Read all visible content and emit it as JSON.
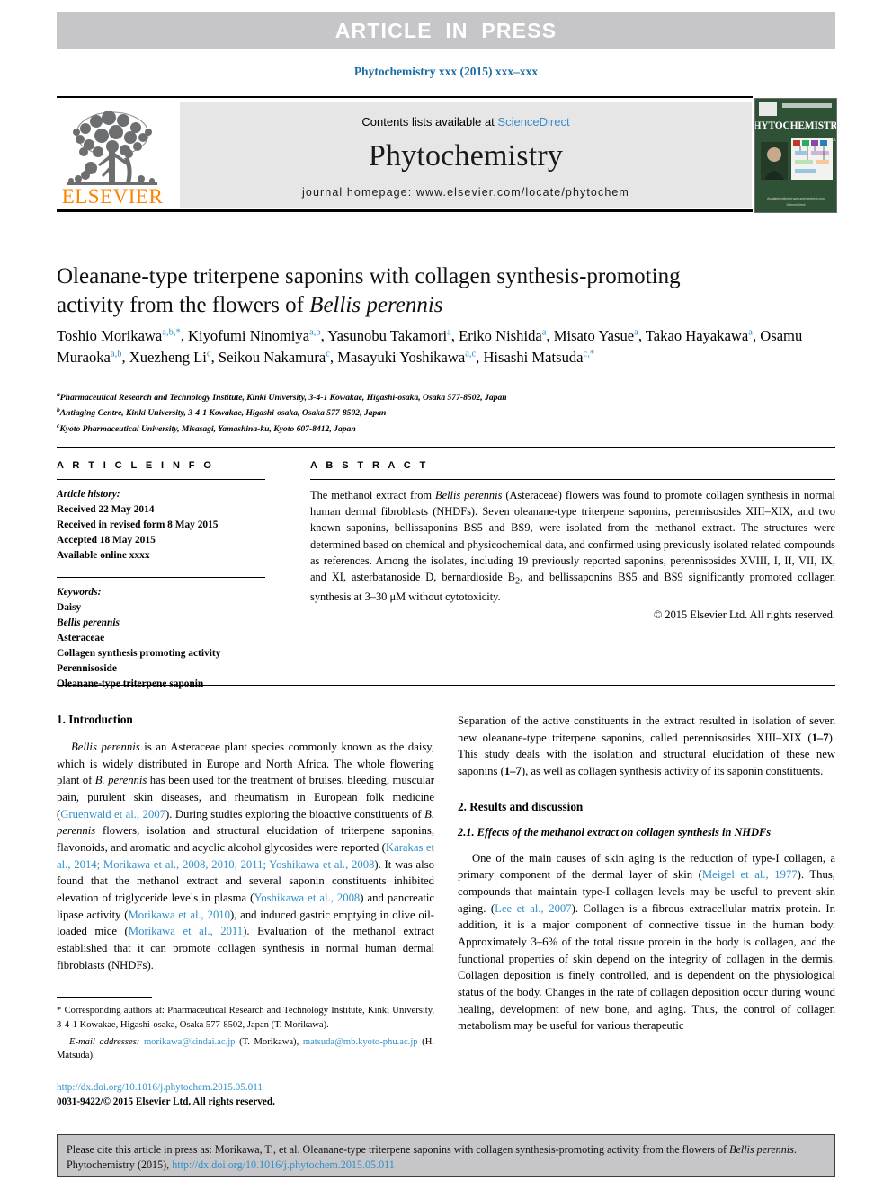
{
  "banner": {
    "text": "ARTICLE  IN  PRESS"
  },
  "running_head": "Phytochemistry xxx (2015) xxx–xxx",
  "masthead": {
    "contents_prefix": "Contents lists available at ",
    "sciencedirect": "ScienceDirect",
    "journal_name": "Phytochemistry",
    "homepage": "journal homepage: www.elsevier.com/locate/phytochem",
    "publisher_wordmark": "ELSEVIER",
    "cover": {
      "title": "PHYTOCHEMISTRY",
      "subtitle_lines": [
        "MOLECULAR BIOLOGY",
        "BIOCHEMISTRY",
        "CHEMISTRY"
      ],
      "footer": "Available online at www.sciencedirect.com"
    }
  },
  "article": {
    "title_line1": "Oleanane-type triterpene saponins with collagen synthesis-promoting",
    "title_line2_pre": "activity from the flowers of ",
    "title_line2_italic": "Bellis perennis",
    "authors_html": "Toshio Morikawa<sup>a,b,*</sup>, Kiyofumi Ninomiya<sup>a,b</sup>, Yasunobu Takamori<sup>a</sup>, Eriko Nishida<sup>a</sup>, Misato Yasue<sup>a</sup>, Takao Hayakawa<sup>a</sup>, Osamu Muraoka<sup>a,b</sup>, Xuezheng Li<sup>c</sup>, Seikou Nakamura<sup>c</sup>, Masayuki Yoshikawa<sup>a,c</sup>, Hisashi Matsuda<sup>c,*</sup>",
    "affiliations": [
      {
        "marker": "a",
        "text": "Pharmaceutical Research and Technology Institute, Kinki University, 3-4-1 Kowakae, Higashi-osaka, Osaka 577-8502, Japan"
      },
      {
        "marker": "b",
        "text": "Antiaging Centre, Kinki University, 3-4-1 Kowakae, Higashi-osaka, Osaka 577-8502, Japan"
      },
      {
        "marker": "c",
        "text": "Kyoto Pharmaceutical University, Misasagi, Yamashina-ku, Kyoto 607-8412, Japan"
      }
    ]
  },
  "article_info": {
    "heading": "A R T I C L E   I N F O",
    "history_label": "Article history:",
    "history": [
      "Received 22 May 2014",
      "Received in revised form 8 May 2015",
      "Accepted 18 May 2015",
      "Available online xxxx"
    ],
    "keywords_label": "Keywords:",
    "keywords": [
      "Daisy",
      "Bellis perennis",
      "Asteraceae",
      "Collagen synthesis promoting activity",
      "Perennisoside",
      "Oleanane-type triterpene saponin"
    ],
    "keywords_italic_index": 1
  },
  "abstract": {
    "heading": "A B S T R A C T",
    "body_html": "The methanol extract from <i>Bellis perennis</i> (Asteraceae) flowers was found to promote collagen synthesis in normal human dermal fibroblasts (NHDFs). Seven oleanane-type triterpene saponins, perennisosides XIII–XIX, and two known saponins, bellissaponins BS5 and BS9, were isolated from the methanol extract. The structures were determined based on chemical and physicochemical data, and confirmed using previously isolated related compounds as references. Among the isolates, including 19 previously reported saponins, perennisosides XVIII, I, II, VII, IX, and XI, asterbatanoside D, bernardioside B<sub>2</sub>, and bellissaponins BS5 and BS9 significantly promoted collagen synthesis at 3–30 μM without cytotoxicity.",
    "copyright": "© 2015 Elsevier Ltd. All rights reserved."
  },
  "body": {
    "left": {
      "intro_heading": "1. Introduction",
      "intro_html": "<i>Bellis perennis</i> is an Asteraceae plant species commonly known as the daisy, which is widely distributed in Europe and North Africa. The whole flowering plant of <i>B. perennis</i> has been used for the treatment of bruises, bleeding, muscular pain, purulent skin diseases, and rheumatism in European folk medicine (<span class=\"cit\">Gruenwald et al., 2007</span>). During studies exploring the bioactive constituents of <i>B. perennis</i> flowers, isolation and structural elucidation of triterpene saponins, flavonoids, and aromatic and acyclic alcohol glycosides were reported (<span class=\"cit\">Karakas et al., 2014; Morikawa et al., 2008, 2010, 2011; Yoshikawa et al., 2008</span>). It was also found that the methanol extract and several saponin constituents inhibited elevation of triglyceride levels in plasma (<span class=\"cit\">Yoshikawa et al., 2008</span>) and pancreatic lipase activity (<span class=\"cit\">Morikawa et al., 2010</span>), and induced gastric emptying in olive oil-loaded mice (<span class=\"cit\">Morikawa et al., 2011</span>). Evaluation of the methanol extract established that it can promote collagen synthesis in normal human dermal fibroblasts (NHDFs).",
      "footnote_corresponding": "* Corresponding authors at: Pharmaceutical Research and Technology Institute, Kinki University, 3-4-1 Kowakae, Higashi-osaka, Osaka 577-8502, Japan (T. Morikawa).",
      "footnote_email_label": "E-mail addresses:",
      "footnote_email_html": "<span class=\"mail\">morikawa@kindai.ac.jp</span> (T. Morikawa), <span class=\"mail\">matsuda@mb.kyoto-phu.ac.jp</span> (H. Matsuda).",
      "doi_url": "http://dx.doi.org/10.1016/j.phytochem.2015.05.011",
      "issn_line": "0031-9422/© 2015 Elsevier Ltd. All rights reserved."
    },
    "right": {
      "para1_html": "Separation of the active constituents in the extract resulted in isolation of seven new oleanane-type triterpene saponins, called perennisosides XIII–XIX (<b>1–7</b>). This study deals with the isolation and structural elucidation of these new saponins (<b>1–7</b>), as well as collagen synthesis activity of its saponin constituents.",
      "results_heading": "2. Results and discussion",
      "subheading_2_1": "2.1. Effects of the methanol extract on collagen synthesis in NHDFs",
      "para2_html": "One of the main causes of skin aging is the reduction of type-I collagen, a primary component of the dermal layer of skin (<span class=\"cit\">Meigel et al., 1977</span>). Thus, compounds that maintain type-I collagen levels may be useful to prevent skin aging. (<span class=\"cit\">Lee et al., 2007</span>). Collagen is a fibrous extracellular matrix protein. In addition, it is a major component of connective tissue in the human body. Approximately 3–6% of the total tissue protein in the body is collagen, and the functional properties of skin depend on the integrity of collagen in the dermis. Collagen deposition is finely controlled, and is dependent on the physiological status of the body. Changes in the rate of collagen deposition occur during wound healing, development of new bone, and aging. Thus, the control of collagen metabolism may be useful for various therapeutic"
    }
  },
  "cite_footer": {
    "text_html": "Please cite this article in press as: Morikawa, T., et al. Oleanane-type triterpene saponins with collagen synthesis-promoting activity from the flowers of <i>Bellis perennis</i>. Phytochemistry (2015), <span class=\"doi-link\">http://dx.doi.org/10.1016/j.phytochem.2015.05.011</span>"
  },
  "colors": {
    "link": "#2f8fc9",
    "banner_bg": "#c6c6c8",
    "masthead_bg": "#e6e6e6",
    "elsevier_orange": "#ff8200",
    "cover_green": "#2f4f33"
  }
}
